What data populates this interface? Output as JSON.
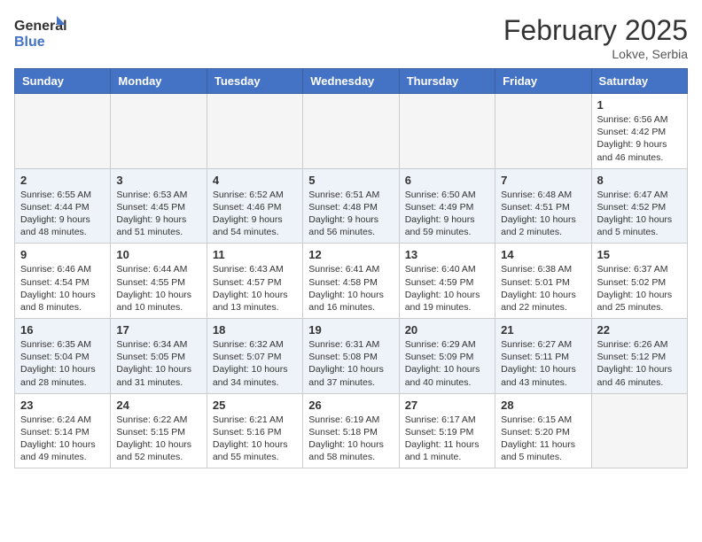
{
  "header": {
    "logo_general": "General",
    "logo_blue": "Blue",
    "month_title": "February 2025",
    "location": "Lokve, Serbia"
  },
  "weekdays": [
    "Sunday",
    "Monday",
    "Tuesday",
    "Wednesday",
    "Thursday",
    "Friday",
    "Saturday"
  ],
  "weeks": [
    [
      {
        "day": "",
        "info": ""
      },
      {
        "day": "",
        "info": ""
      },
      {
        "day": "",
        "info": ""
      },
      {
        "day": "",
        "info": ""
      },
      {
        "day": "",
        "info": ""
      },
      {
        "day": "",
        "info": ""
      },
      {
        "day": "1",
        "info": "Sunrise: 6:56 AM\nSunset: 4:42 PM\nDaylight: 9 hours\nand 46 minutes."
      }
    ],
    [
      {
        "day": "2",
        "info": "Sunrise: 6:55 AM\nSunset: 4:44 PM\nDaylight: 9 hours\nand 48 minutes."
      },
      {
        "day": "3",
        "info": "Sunrise: 6:53 AM\nSunset: 4:45 PM\nDaylight: 9 hours\nand 51 minutes."
      },
      {
        "day": "4",
        "info": "Sunrise: 6:52 AM\nSunset: 4:46 PM\nDaylight: 9 hours\nand 54 minutes."
      },
      {
        "day": "5",
        "info": "Sunrise: 6:51 AM\nSunset: 4:48 PM\nDaylight: 9 hours\nand 56 minutes."
      },
      {
        "day": "6",
        "info": "Sunrise: 6:50 AM\nSunset: 4:49 PM\nDaylight: 9 hours\nand 59 minutes."
      },
      {
        "day": "7",
        "info": "Sunrise: 6:48 AM\nSunset: 4:51 PM\nDaylight: 10 hours\nand 2 minutes."
      },
      {
        "day": "8",
        "info": "Sunrise: 6:47 AM\nSunset: 4:52 PM\nDaylight: 10 hours\nand 5 minutes."
      }
    ],
    [
      {
        "day": "9",
        "info": "Sunrise: 6:46 AM\nSunset: 4:54 PM\nDaylight: 10 hours\nand 8 minutes."
      },
      {
        "day": "10",
        "info": "Sunrise: 6:44 AM\nSunset: 4:55 PM\nDaylight: 10 hours\nand 10 minutes."
      },
      {
        "day": "11",
        "info": "Sunrise: 6:43 AM\nSunset: 4:57 PM\nDaylight: 10 hours\nand 13 minutes."
      },
      {
        "day": "12",
        "info": "Sunrise: 6:41 AM\nSunset: 4:58 PM\nDaylight: 10 hours\nand 16 minutes."
      },
      {
        "day": "13",
        "info": "Sunrise: 6:40 AM\nSunset: 4:59 PM\nDaylight: 10 hours\nand 19 minutes."
      },
      {
        "day": "14",
        "info": "Sunrise: 6:38 AM\nSunset: 5:01 PM\nDaylight: 10 hours\nand 22 minutes."
      },
      {
        "day": "15",
        "info": "Sunrise: 6:37 AM\nSunset: 5:02 PM\nDaylight: 10 hours\nand 25 minutes."
      }
    ],
    [
      {
        "day": "16",
        "info": "Sunrise: 6:35 AM\nSunset: 5:04 PM\nDaylight: 10 hours\nand 28 minutes."
      },
      {
        "day": "17",
        "info": "Sunrise: 6:34 AM\nSunset: 5:05 PM\nDaylight: 10 hours\nand 31 minutes."
      },
      {
        "day": "18",
        "info": "Sunrise: 6:32 AM\nSunset: 5:07 PM\nDaylight: 10 hours\nand 34 minutes."
      },
      {
        "day": "19",
        "info": "Sunrise: 6:31 AM\nSunset: 5:08 PM\nDaylight: 10 hours\nand 37 minutes."
      },
      {
        "day": "20",
        "info": "Sunrise: 6:29 AM\nSunset: 5:09 PM\nDaylight: 10 hours\nand 40 minutes."
      },
      {
        "day": "21",
        "info": "Sunrise: 6:27 AM\nSunset: 5:11 PM\nDaylight: 10 hours\nand 43 minutes."
      },
      {
        "day": "22",
        "info": "Sunrise: 6:26 AM\nSunset: 5:12 PM\nDaylight: 10 hours\nand 46 minutes."
      }
    ],
    [
      {
        "day": "23",
        "info": "Sunrise: 6:24 AM\nSunset: 5:14 PM\nDaylight: 10 hours\nand 49 minutes."
      },
      {
        "day": "24",
        "info": "Sunrise: 6:22 AM\nSunset: 5:15 PM\nDaylight: 10 hours\nand 52 minutes."
      },
      {
        "day": "25",
        "info": "Sunrise: 6:21 AM\nSunset: 5:16 PM\nDaylight: 10 hours\nand 55 minutes."
      },
      {
        "day": "26",
        "info": "Sunrise: 6:19 AM\nSunset: 5:18 PM\nDaylight: 10 hours\nand 58 minutes."
      },
      {
        "day": "27",
        "info": "Sunrise: 6:17 AM\nSunset: 5:19 PM\nDaylight: 11 hours\nand 1 minute."
      },
      {
        "day": "28",
        "info": "Sunrise: 6:15 AM\nSunset: 5:20 PM\nDaylight: 11 hours\nand 5 minutes."
      },
      {
        "day": "",
        "info": ""
      }
    ]
  ]
}
